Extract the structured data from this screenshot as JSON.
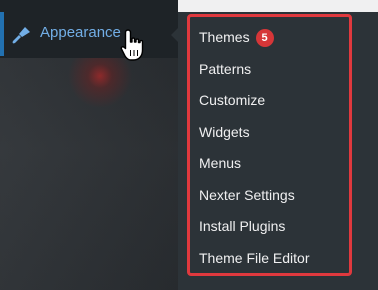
{
  "sidebar": {
    "appearance": {
      "label": "Appearance",
      "icon": "paintbrush-icon"
    }
  },
  "submenu": {
    "items": [
      {
        "label": "Themes",
        "badge": "5"
      },
      {
        "label": "Patterns"
      },
      {
        "label": "Customize"
      },
      {
        "label": "Widgets"
      },
      {
        "label": "Menus"
      },
      {
        "label": "Nexter Settings"
      },
      {
        "label": "Install Plugins"
      },
      {
        "label": "Theme File Editor"
      }
    ]
  },
  "colors": {
    "sidebar_bg": "#1e2327",
    "submenu_bg": "#2c3338",
    "accent": "#72aee6",
    "active_bar": "#2271b1",
    "highlight_frame": "#e0393e",
    "badge": "#d63638"
  }
}
